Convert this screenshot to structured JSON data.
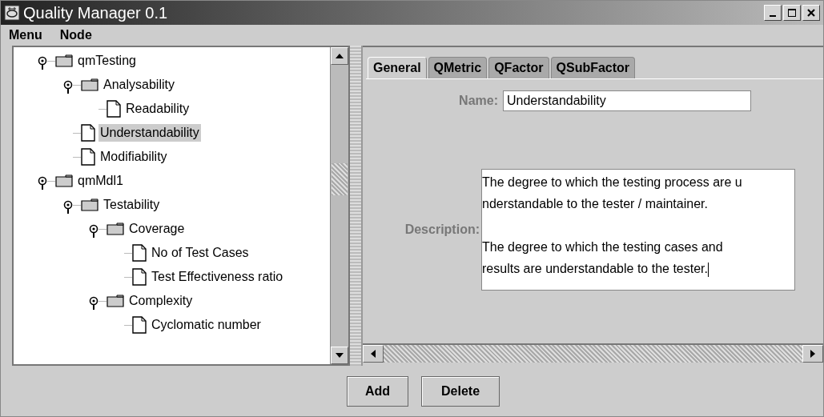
{
  "window": {
    "title": "Quality Manager 0.1"
  },
  "menu": [
    "Menu",
    "Node"
  ],
  "tree": [
    {
      "label": "qmTesting",
      "kind": "folder",
      "expanded": true,
      "selected": false,
      "children": [
        {
          "label": "Analysability",
          "kind": "folder",
          "expanded": true,
          "selected": false,
          "children": [
            {
              "label": "Readability",
              "kind": "leaf",
              "selected": false
            }
          ]
        },
        {
          "label": "Understandability",
          "kind": "leaf",
          "selected": true
        },
        {
          "label": "Modifiability",
          "kind": "leaf",
          "selected": false
        }
      ]
    },
    {
      "label": "qmMdl1",
      "kind": "folder",
      "expanded": true,
      "selected": false,
      "children": [
        {
          "label": "Testability",
          "kind": "folder",
          "expanded": true,
          "selected": false,
          "children": [
            {
              "label": "Coverage",
              "kind": "folder",
              "expanded": true,
              "selected": false,
              "children": [
                {
                  "label": "No of Test Cases",
                  "kind": "leaf",
                  "selected": false
                },
                {
                  "label": "Test Effectiveness ratio",
                  "kind": "leaf",
                  "selected": false
                }
              ]
            },
            {
              "label": "Complexity",
              "kind": "folder",
              "expanded": true,
              "selected": false,
              "children": [
                {
                  "label": "Cyclomatic number",
                  "kind": "leaf",
                  "selected": false
                }
              ]
            }
          ]
        }
      ]
    }
  ],
  "tabs": [
    {
      "label": "General",
      "selected": true
    },
    {
      "label": "QMetric",
      "selected": false
    },
    {
      "label": "QFactor",
      "selected": false
    },
    {
      "label": "QSubFactor",
      "selected": false
    }
  ],
  "form": {
    "name_label": "Name:",
    "name_value": "Understandability",
    "description_label": "Description:",
    "description_paragraphs": [
      [
        "The degree to which the testing process are u",
        "nderstandable to the tester / maintainer."
      ],
      [
        "The degree to which the testing cases and",
        "results are understandable to the tester."
      ]
    ]
  },
  "buttons": [
    "Add",
    "Delete"
  ]
}
